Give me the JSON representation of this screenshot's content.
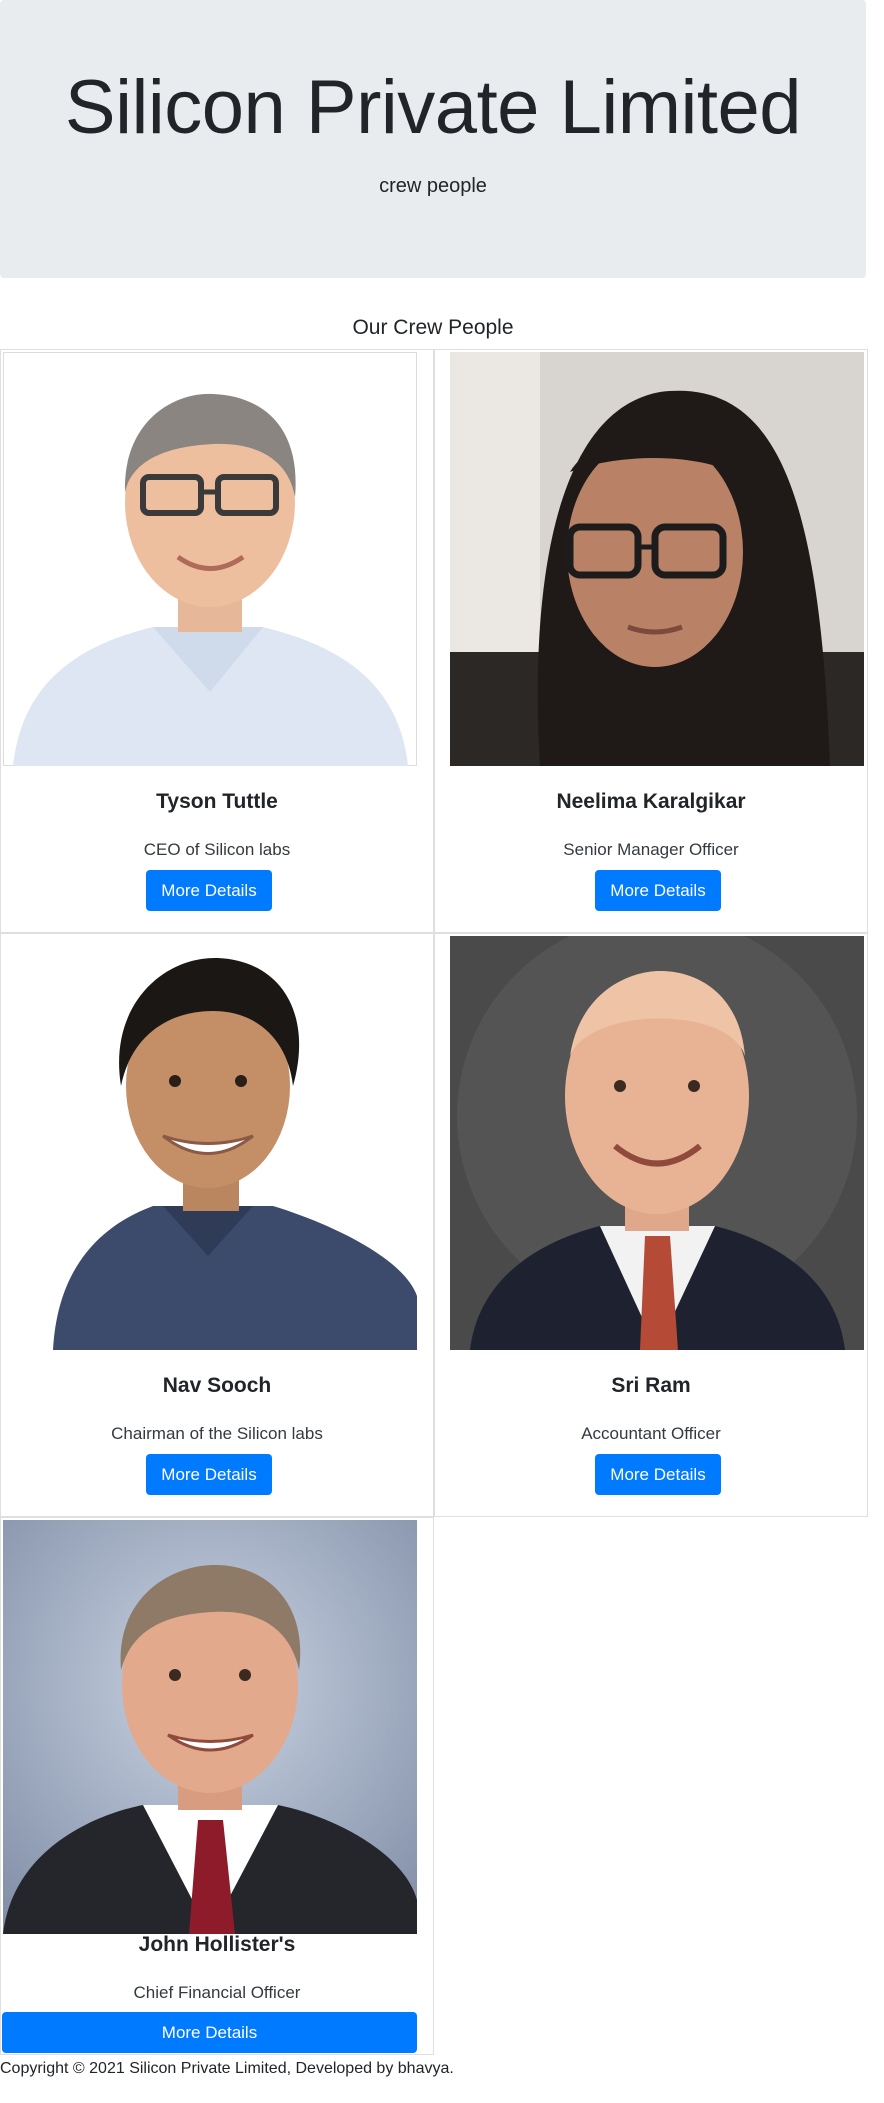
{
  "header": {
    "title": "Silicon Private Limited",
    "subtitle": "crew people"
  },
  "section_title": "Our Crew People",
  "crew": [
    {
      "name": "Tyson Tuttle",
      "role": "CEO of Silicon labs",
      "button": "More Details"
    },
    {
      "name": "Neelima Karalgikar",
      "role": "Senior Manager Officer",
      "button": "More Details"
    },
    {
      "name": "Nav Sooch",
      "role": "Chairman of the Silicon labs",
      "button": "More Details"
    },
    {
      "name": "Sri Ram",
      "role": "Accountant Officer",
      "button": "More Details"
    },
    {
      "name": "John Hollister's",
      "role": "Chief Financial Officer",
      "button": "More Details"
    }
  ],
  "footer": {
    "text": "Copyright © 2021 Silicon Private Limited, Developed by bhavya."
  },
  "colors": {
    "primary": "#007bff",
    "jumbotron_bg": "#e9ecef"
  }
}
